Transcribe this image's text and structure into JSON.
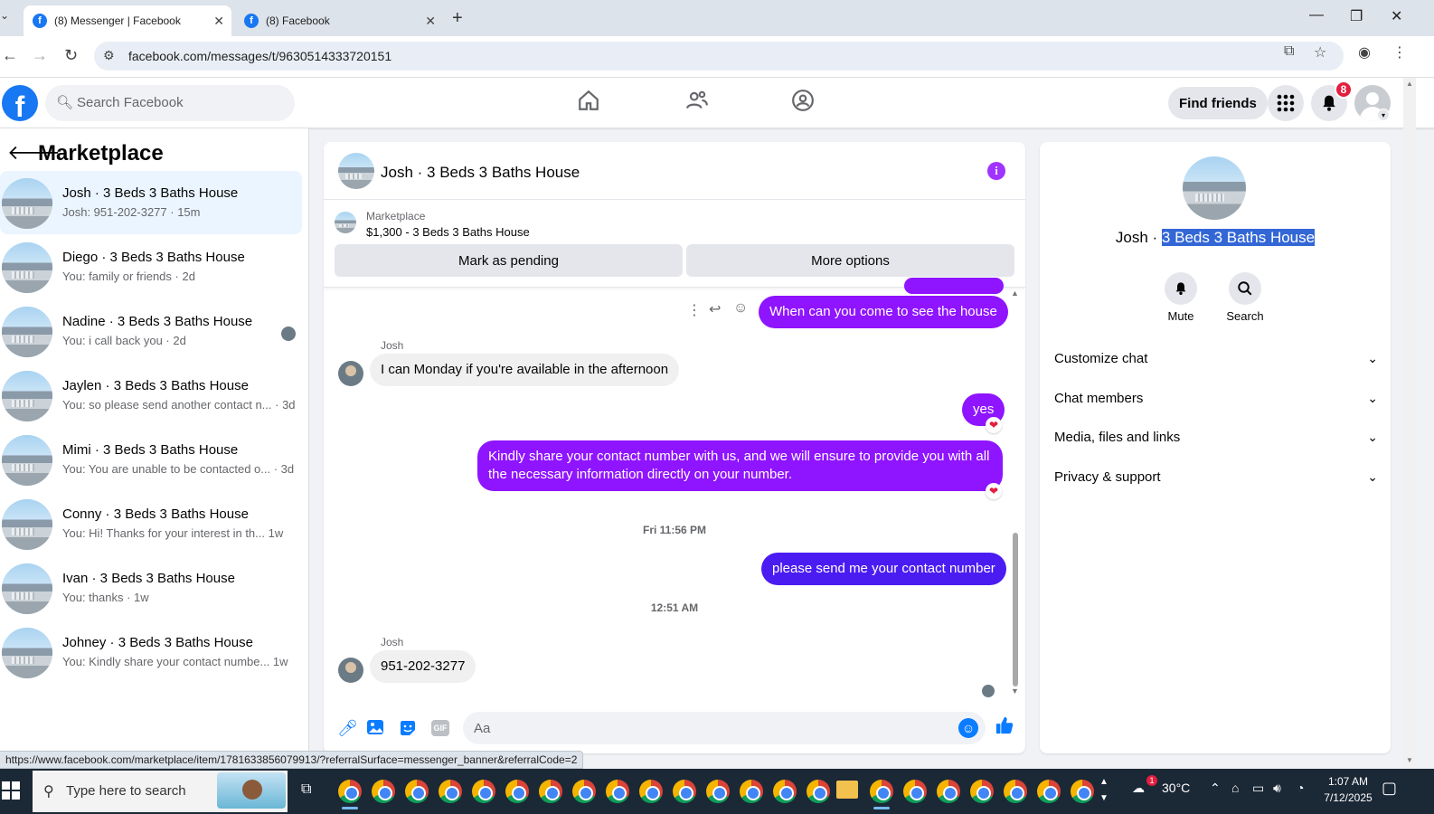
{
  "browser": {
    "tabs": [
      {
        "title": "(8) Messenger | Facebook",
        "active": true
      },
      {
        "title": "(8) Facebook",
        "active": false
      }
    ],
    "new_tab_glyph": "+",
    "url": "facebook.com/messages/t/9630514333720151",
    "status_url": "https://www.facebook.com/marketplace/item/1781633856079913/?referralSurface=messenger_banner&referralCode=2"
  },
  "fb_header": {
    "logo_letter": "f",
    "search_placeholder": "Search Facebook",
    "find_friends_label": "Find friends",
    "notification_count": "8"
  },
  "left_panel": {
    "title": "Marketplace",
    "conversations": [
      {
        "name": "Josh · 3 Beds 3 Baths House",
        "preview": "Josh: 951-202-3277 · 15m",
        "selected": true
      },
      {
        "name": "Diego · 3 Beds 3 Baths House",
        "preview": "You: family or friends · 2d"
      },
      {
        "name": "Nadine · 3 Beds 3 Baths House",
        "preview": "You: i call back you · 2d"
      },
      {
        "name": "Jaylen · 3 Beds 3 Baths House",
        "preview": "You: so please send another contact n... · 3d"
      },
      {
        "name": "Mimi · 3 Beds 3 Baths House",
        "preview": "You: You are unable to be contacted o... · 3d"
      },
      {
        "name": "Conny · 3 Beds 3 Baths House",
        "preview": "You: Hi! Thanks for your interest in th...   1w"
      },
      {
        "name": "Ivan · 3 Beds 3 Baths House",
        "preview": "You: thanks · 1w"
      },
      {
        "name": "Johney · 3 Beds 3 Baths House",
        "preview": "You: Kindly share your contact numbe...   1w"
      }
    ]
  },
  "chat": {
    "title": "Josh · 3 Beds 3 Baths House",
    "info_glyph": "i",
    "banner": {
      "label": "Marketplace",
      "price_line": "$1,300 - 3 Beds 3 Baths House",
      "mark_pending_label": "Mark as pending",
      "more_options_label": "More options"
    },
    "messages": {
      "m1": "When can you come to see the house",
      "sender1": "Josh",
      "m2": "I can Monday if you're available in the afternoon",
      "m3": "yes",
      "m4": "Kindly share your contact number with us, and we will ensure to provide you with all the necessary information directly on your number.",
      "ts1": "Fri 11:56 PM",
      "m5": "please send me your contact number",
      "ts2": "12:51 AM",
      "sender2": "Josh",
      "m6": "951-202-3277"
    },
    "composer_placeholder": "Aa",
    "gif_label": "GIF"
  },
  "right_panel": {
    "name_prefix": "Josh · ",
    "name_highlight": "3 Beds 3 Baths House",
    "mute_label": "Mute",
    "search_label": "Search",
    "sections": [
      "Customize chat",
      "Chat members",
      "Media, files and links",
      "Privacy & support"
    ]
  },
  "taskbar": {
    "search_placeholder": "Type here to search",
    "weather": "30°C",
    "time": "1:07 AM",
    "date": "7/12/2025",
    "weather_badge": "1"
  },
  "colors": {
    "fb_blue": "#1877f2",
    "bubble_purple": "#8f14ff",
    "bubble_indigo": "#4b1cf2",
    "selected_bg": "#ebf5ff",
    "highlight": "#3367d6"
  }
}
